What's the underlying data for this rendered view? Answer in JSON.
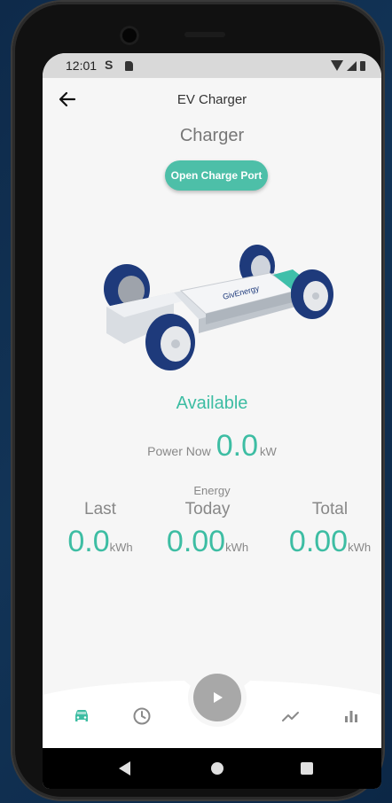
{
  "status_bar": {
    "time": "12:01",
    "s_icon": "S"
  },
  "appbar": {
    "title": "EV Charger"
  },
  "page": {
    "section_title": "Charger",
    "open_port_label": "Open Charge Port",
    "car_brand": "GivEnergy",
    "charger_status": "Available"
  },
  "power": {
    "label": "Power Now",
    "value": "0.0",
    "unit": "kW"
  },
  "energy": {
    "label": "Energy",
    "columns": [
      {
        "label": "Last",
        "value": "0.0",
        "unit": "kWh"
      },
      {
        "label": "Today",
        "value": "0.00",
        "unit": "kWh"
      },
      {
        "label": "Total",
        "value": "0.00",
        "unit": "kWh"
      }
    ]
  },
  "colors": {
    "accent": "#3dbda3",
    "button": "#4dbfa8",
    "fab": "#a8a8a8"
  },
  "nav": {
    "items": [
      "car-icon",
      "history-clock-icon",
      "play-icon",
      "trend-line-icon",
      "bar-chart-icon"
    ]
  }
}
